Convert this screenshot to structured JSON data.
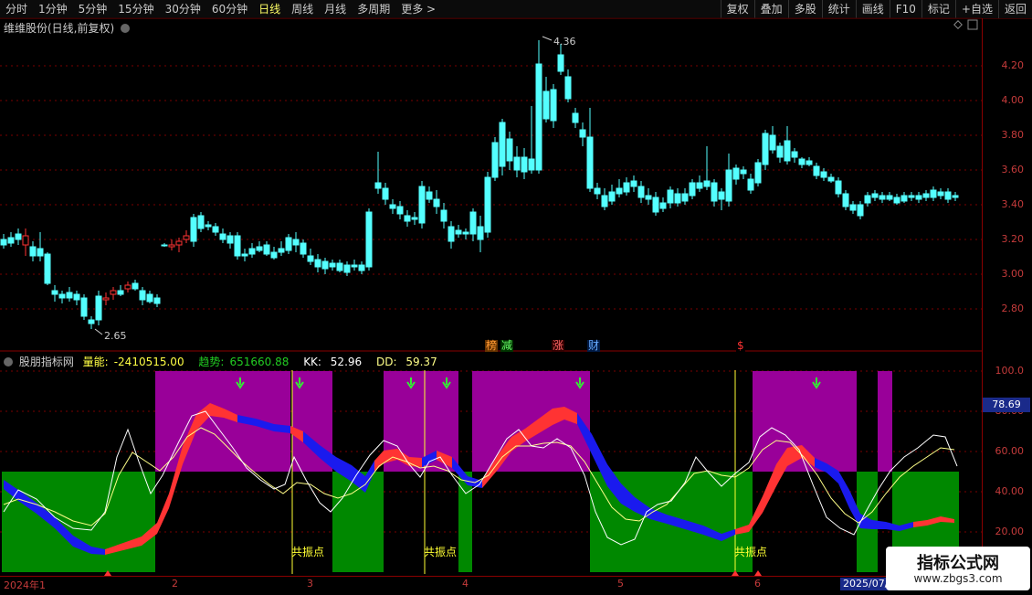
{
  "toolbar": {
    "periods": [
      "分时",
      "1分钟",
      "5分钟",
      "15分钟",
      "30分钟",
      "60分钟",
      "日线",
      "周线",
      "月线",
      "多周期",
      "更多 >"
    ],
    "active_period": "日线",
    "right_buttons": [
      "复权",
      "叠加",
      "多股",
      "统计",
      "画线",
      "F10",
      "标记",
      "+自选",
      "返回"
    ]
  },
  "main_chart": {
    "title": "维维股份(日线,前复权)",
    "price_axis": [
      "4.20",
      "4.00",
      "3.80",
      "3.60",
      "3.40",
      "3.20",
      "3.00",
      "2.80"
    ],
    "max_label": "4.36",
    "min_label": "2.65",
    "signals": [
      {
        "text": "榜",
        "color": "#ff9933",
        "bg": "#663300"
      },
      {
        "text": "减",
        "color": "#66ff66",
        "bg": "#003300"
      },
      {
        "text": "涨",
        "color": "#ff6666",
        "bg": "#330000"
      },
      {
        "text": "财",
        "color": "#66aaff",
        "bg": "#001a44"
      },
      {
        "text": "$",
        "color": "#ff3333",
        "bg": "#000"
      }
    ]
  },
  "indicator": {
    "name": "股朋指标网",
    "liangneng_label": "量能:",
    "liangneng_value": "-2410515.00",
    "qushi_label": "趋势:",
    "qushi_value": "651660.88",
    "kk_label": "KK:",
    "kk_value": "52.96",
    "dd_label": "DD:",
    "dd_value": "59.37",
    "axis": [
      "100.0",
      "80.00",
      "60.00",
      "40.00",
      "20.00"
    ],
    "current_value": "78.69",
    "resonance_label": "共振点"
  },
  "x_axis": {
    "labels": [
      "2024年1",
      "2",
      "3",
      "4",
      "5",
      "6"
    ],
    "current_date": "2025/07/"
  },
  "watermark": {
    "line1": "指标公式网",
    "line2": "www.zbgs3.com"
  },
  "colors": {
    "up": "#ff3333",
    "down": "#54ffff",
    "purple": "#990099",
    "green": "#008800",
    "red_band": "#ff3333",
    "blue_band": "#1a1aee"
  }
}
